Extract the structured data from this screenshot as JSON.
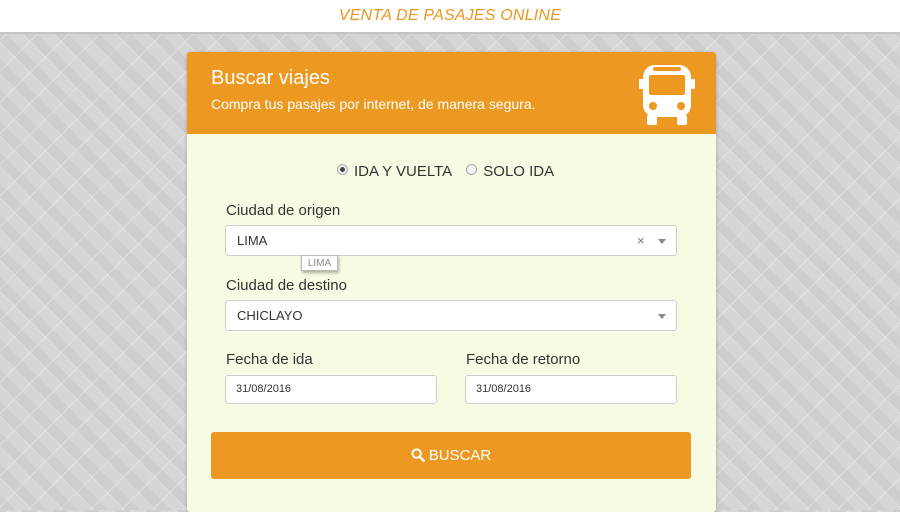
{
  "topbar": {
    "title": "VENTA DE PASAJES ONLINE"
  },
  "header": {
    "title": "Buscar viajes",
    "subtitle": "Compra tus pasajes por internet, de manera segura.",
    "icon": "bus-icon"
  },
  "trip_type": {
    "options": [
      {
        "label": "IDA Y VUELTA",
        "checked": true
      },
      {
        "label": "SOLO IDA",
        "checked": false
      }
    ]
  },
  "origin": {
    "label": "Ciudad de origen",
    "value": "LIMA",
    "tooltip": "LIMA",
    "clear": "×"
  },
  "destination": {
    "label": "Ciudad de destino",
    "value": "CHICLAYO"
  },
  "departure": {
    "label": "Fecha de ida",
    "value": "31/08/2016"
  },
  "return": {
    "label": "Fecha de retorno",
    "value": "31/08/2016"
  },
  "search_button": {
    "label": "BUSCAR",
    "icon": "search-icon"
  },
  "colors": {
    "accent": "#ec9821",
    "panel": "#f8fbe3"
  }
}
